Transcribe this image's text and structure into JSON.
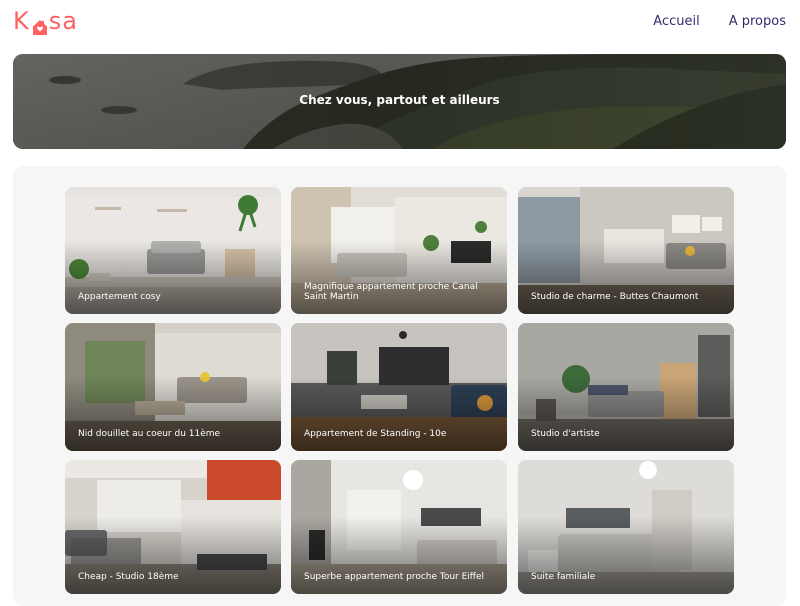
{
  "header": {
    "logo_prefix": "K",
    "logo_suffix": "sa",
    "nav": [
      "Accueil",
      "A propos"
    ]
  },
  "banner": {
    "title": "Chez vous, partout et ailleurs"
  },
  "listings": [
    "Appartement cosy",
    "Magnifique appartement proche Canal Saint Martin",
    "Studio de charme - Buttes Chaumont",
    "Nid douillet au coeur du 11ème",
    "Appartement de Standing - 10e",
    "Studio d'artiste",
    "Cheap - Studio 18ème",
    "Superbe appartement proche Tour Eiffel",
    "Suite familiale"
  ],
  "colors": {
    "brand": "#ff6060",
    "nav_text": "#3a2a6a",
    "gallery_bg": "#f6f6f6"
  }
}
